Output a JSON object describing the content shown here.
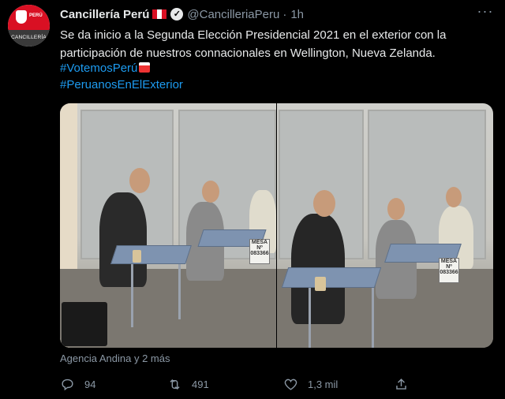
{
  "tweet": {
    "author_name": "Cancillería Perú",
    "handle": "@CancilleriaPeru",
    "separator": "·",
    "time": "1h",
    "avatar_text": "CANCILLERÍA",
    "avatar_flag_text": "PERÚ",
    "text": "Se da inicio a la Segunda Elección Presidencial 2021 en el exterior con la participación de nuestros connacionales en Wellington, Nueva Zelanda.",
    "hashtags": [
      "#VotemosPerú",
      "#PeruanosEnElExterior"
    ],
    "media_source": "Agencia Andina y 2 más",
    "photo_sign_text": "MESA Nº 083366",
    "actions": {
      "replies": "94",
      "retweets": "491",
      "likes": "1,3 mil"
    }
  },
  "colors": {
    "background": "#000000",
    "link": "#1d9bf0",
    "muted": "#8b98a5",
    "peru_red": "#d91023"
  },
  "icons": [
    "flag-peru-icon",
    "verified-badge-icon",
    "more-options-icon",
    "ballot-box-icon",
    "reply-icon",
    "retweet-icon",
    "like-icon",
    "share-icon"
  ]
}
